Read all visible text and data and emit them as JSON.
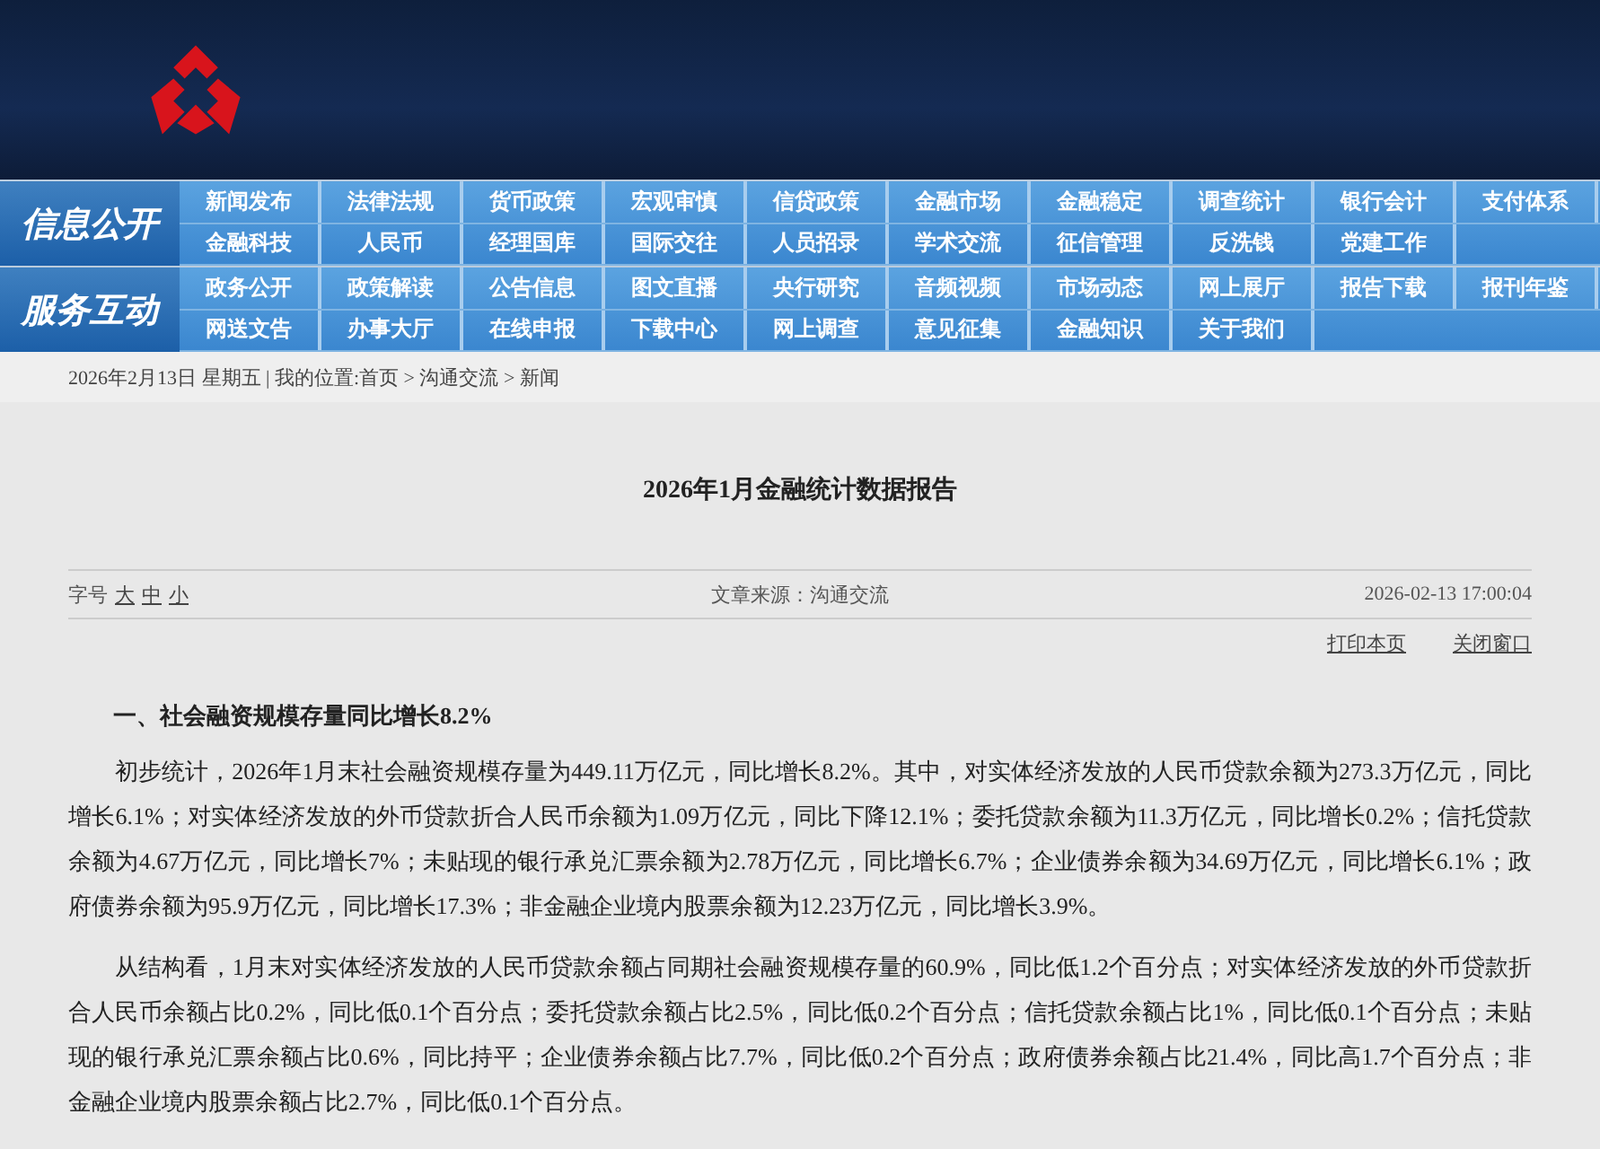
{
  "nav_sections": [
    {
      "title": "信息公开",
      "rows": [
        [
          "新闻发布",
          "法律法规",
          "货币政策",
          "宏观审慎",
          "信贷政策",
          "金融市场",
          "金融稳定",
          "调查统计",
          "银行会计",
          "支付体系"
        ],
        [
          "金融科技",
          "人民币",
          "经理国库",
          "国际交往",
          "人员招录",
          "学术交流",
          "征信管理",
          "反洗钱",
          "党建工作"
        ]
      ]
    },
    {
      "title": "服务互动",
      "rows": [
        [
          "政务公开",
          "政策解读",
          "公告信息",
          "图文直播",
          "央行研究",
          "音频视频",
          "市场动态",
          "网上展厅",
          "报告下载",
          "报刊年鉴"
        ],
        [
          "网送文告",
          "办事大厅",
          "在线申报",
          "下载中心",
          "网上调查",
          "意见征集",
          "金融知识",
          "关于我们"
        ]
      ]
    }
  ],
  "breadcrumb": "2026年2月13日 星期五 | 我的位置:首页 > 沟通交流 > 新闻",
  "article": {
    "title": "2026年1月金融统计数据报告",
    "font_size_label": "字号",
    "font_sizes": [
      "大",
      "中",
      "小"
    ],
    "source": "文章来源：沟通交流",
    "datetime": "2026-02-13 17:00:04",
    "actions": [
      "打印本页",
      "关闭窗口"
    ],
    "heading": "一、社会融资规模存量同比增长8.2%",
    "paragraphs": [
      "初步统计，2026年1月末社会融资规模存量为449.11万亿元，同比增长8.2%。其中，对实体经济发放的人民币贷款余额为273.3万亿元，同比增长6.1%；对实体经济发放的外币贷款折合人民币余额为1.09万亿元，同比下降12.1%；委托贷款余额为11.3万亿元，同比增长0.2%；信托贷款余额为4.67万亿元，同比增长7%；未贴现的银行承兑汇票余额为2.78万亿元，同比增长6.7%；企业债券余额为34.69万亿元，同比增长6.1%；政府债券余额为95.9万亿元，同比增长17.3%；非金融企业境内股票余额为12.23万亿元，同比增长3.9%。",
      "从结构看，1月末对实体经济发放的人民币贷款余额占同期社会融资规模存量的60.9%，同比低1.2个百分点；对实体经济发放的外币贷款折合人民币余额占比0.2%，同比低0.1个百分点；委托贷款余额占比2.5%，同比低0.2个百分点；信托贷款余额占比1%，同比低0.1个百分点；未贴现的银行承兑汇票余额占比0.6%，同比持平；企业债券余额占比7.7%，同比低0.2个百分点；政府债券余额占比21.4%，同比高1.7个百分点；非金融企业境内股票余额占比2.7%，同比低0.1个百分点。"
    ]
  }
}
